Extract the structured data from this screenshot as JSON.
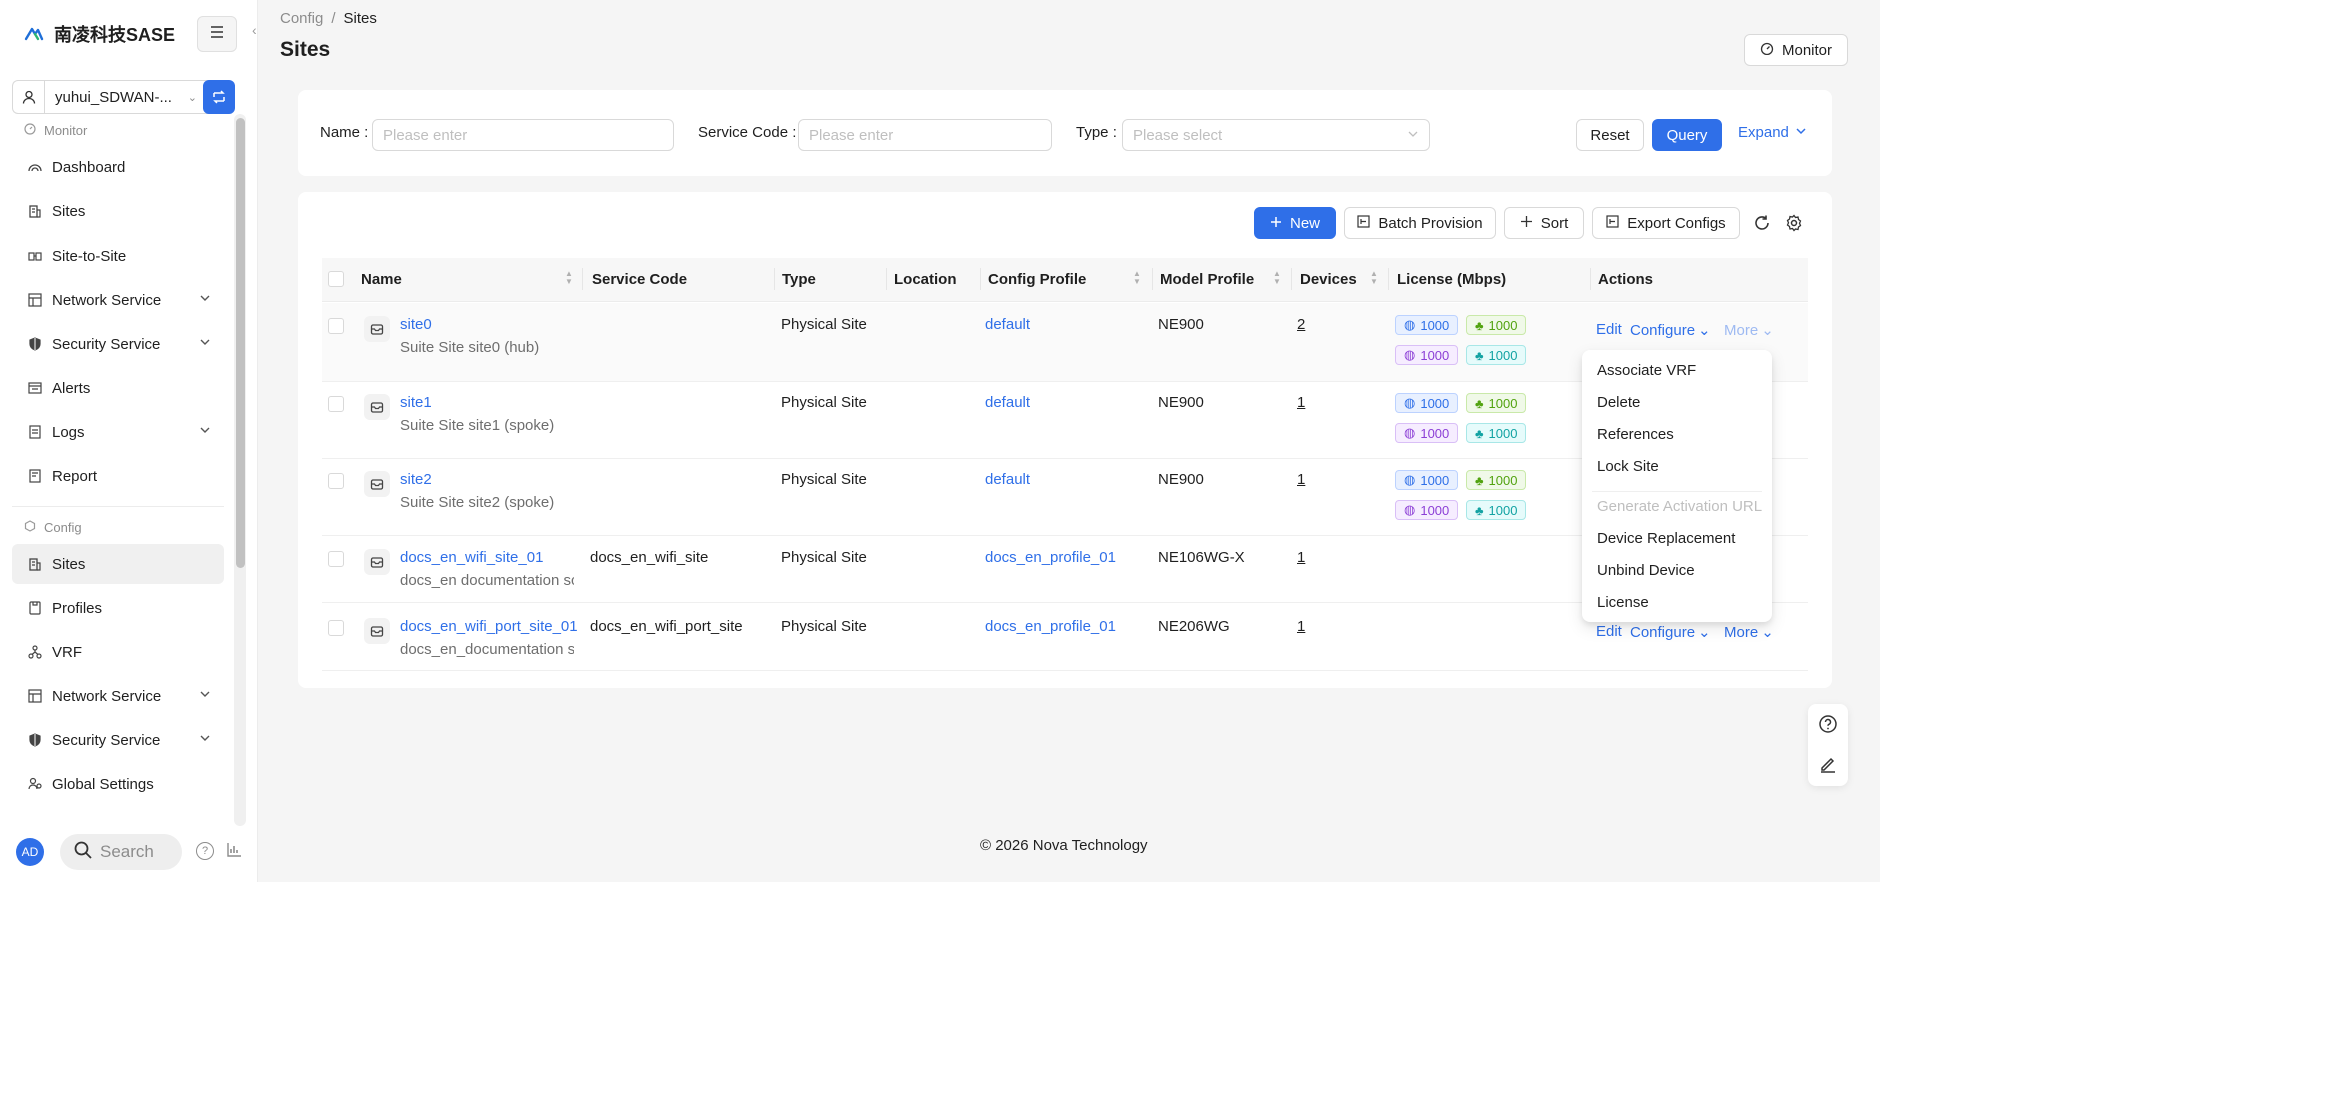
{
  "brand": {
    "title": "南凌科技SASE"
  },
  "tenant": {
    "name": "yuhui_SDWAN-..."
  },
  "sidebar": {
    "groups": [
      {
        "title": "Monitor",
        "items": [
          {
            "label": "Dashboard",
            "icon": "dashboard-icon"
          },
          {
            "label": "Sites",
            "icon": "building-icon"
          },
          {
            "label": "Site-to-Site",
            "icon": "site-link-icon"
          },
          {
            "label": "Network Service",
            "icon": "network-icon",
            "expandable": true
          },
          {
            "label": "Security Service",
            "icon": "shield-icon",
            "expandable": true
          },
          {
            "label": "Alerts",
            "icon": "alert-icon"
          },
          {
            "label": "Logs",
            "icon": "logs-icon",
            "expandable": true
          },
          {
            "label": "Report",
            "icon": "report-icon"
          }
        ]
      },
      {
        "title": "Config",
        "items": [
          {
            "label": "Sites",
            "icon": "building-icon",
            "active": true
          },
          {
            "label": "Profiles",
            "icon": "profile-icon"
          },
          {
            "label": "VRF",
            "icon": "vrf-icon"
          },
          {
            "label": "Network Service",
            "icon": "network-icon",
            "expandable": true
          },
          {
            "label": "Security Service",
            "icon": "shield-icon",
            "expandable": true
          },
          {
            "label": "Global Settings",
            "icon": "settings-users-icon"
          }
        ]
      }
    ],
    "footer": {
      "avatar": "AD",
      "search_placeholder": "Search"
    }
  },
  "breadcrumb": [
    "Config",
    "Sites"
  ],
  "breadcrumb_sep": "/",
  "page": {
    "title": "Sites",
    "monitor_label": "Monitor"
  },
  "filters": {
    "name_label": "Name",
    "name_placeholder": "Please enter",
    "service_code_label": "Service Code",
    "service_code_placeholder": "Please enter",
    "type_label": "Type",
    "type_placeholder": "Please select",
    "reset_label": "Reset",
    "query_label": "Query",
    "expand_label": "Expand"
  },
  "toolbar": {
    "new_label": "New",
    "batch_label": "Batch Provision",
    "sort_label": "Sort",
    "export_label": "Export Configs"
  },
  "table": {
    "columns": [
      "Name",
      "Service Code",
      "Type",
      "Location",
      "Config Profile",
      "Model Profile",
      "Devices",
      "License (Mbps)",
      "Actions"
    ],
    "rows": [
      {
        "name": "site0",
        "desc": "Suite Site site0 (hub)",
        "service_code": "",
        "type": "Physical Site",
        "location": "",
        "config_profile": "default",
        "model_profile": "NE900",
        "devices": "2",
        "licenses": [
          "1000",
          "1000",
          "1000",
          "1000"
        ]
      },
      {
        "name": "site1",
        "desc": "Suite Site site1 (spoke)",
        "service_code": "",
        "type": "Physical Site",
        "location": "",
        "config_profile": "default",
        "model_profile": "NE900",
        "devices": "1",
        "licenses": [
          "1000",
          "1000",
          "1000",
          "1000"
        ]
      },
      {
        "name": "site2",
        "desc": "Suite Site site2 (spoke)",
        "service_code": "",
        "type": "Physical Site",
        "location": "",
        "config_profile": "default",
        "model_profile": "NE900",
        "devices": "1",
        "licenses": [
          "1000",
          "1000",
          "1000",
          "1000"
        ]
      },
      {
        "name": "docs_en_wifi_site_01",
        "desc": "docs_en documentation sc",
        "service_code": "docs_en_wifi_site",
        "type": "Physical Site",
        "location": "",
        "config_profile": "docs_en_profile_01",
        "model_profile": "NE106WG-X",
        "devices": "1",
        "licenses": []
      },
      {
        "name": "docs_en_wifi_port_site_01",
        "desc": "docs_en_documentation sc",
        "service_code": "docs_en_wifi_port_site",
        "type": "Physical Site",
        "location": "",
        "config_profile": "docs_en_profile_01",
        "model_profile": "NE206WG",
        "devices": "1",
        "licenses": []
      }
    ],
    "actions": {
      "edit": "Edit",
      "configure": "Configure",
      "more": "More"
    }
  },
  "dropdown": {
    "items": [
      {
        "label": "Associate VRF",
        "disabled": false
      },
      {
        "label": "Delete",
        "disabled": false
      },
      {
        "label": "References",
        "disabled": false
      },
      {
        "label": "Lock Site",
        "disabled": false
      },
      {
        "label": "Generate Activation URL",
        "disabled": true
      },
      {
        "label": "Device Replacement",
        "disabled": false
      },
      {
        "label": "Unbind Device",
        "disabled": false
      },
      {
        "label": "License",
        "disabled": false
      }
    ]
  },
  "footer": {
    "copyright": "© 2026 Nova Technology"
  },
  "colors": {
    "primary": "#2f6fe8",
    "bg": "#f5f5f5"
  }
}
